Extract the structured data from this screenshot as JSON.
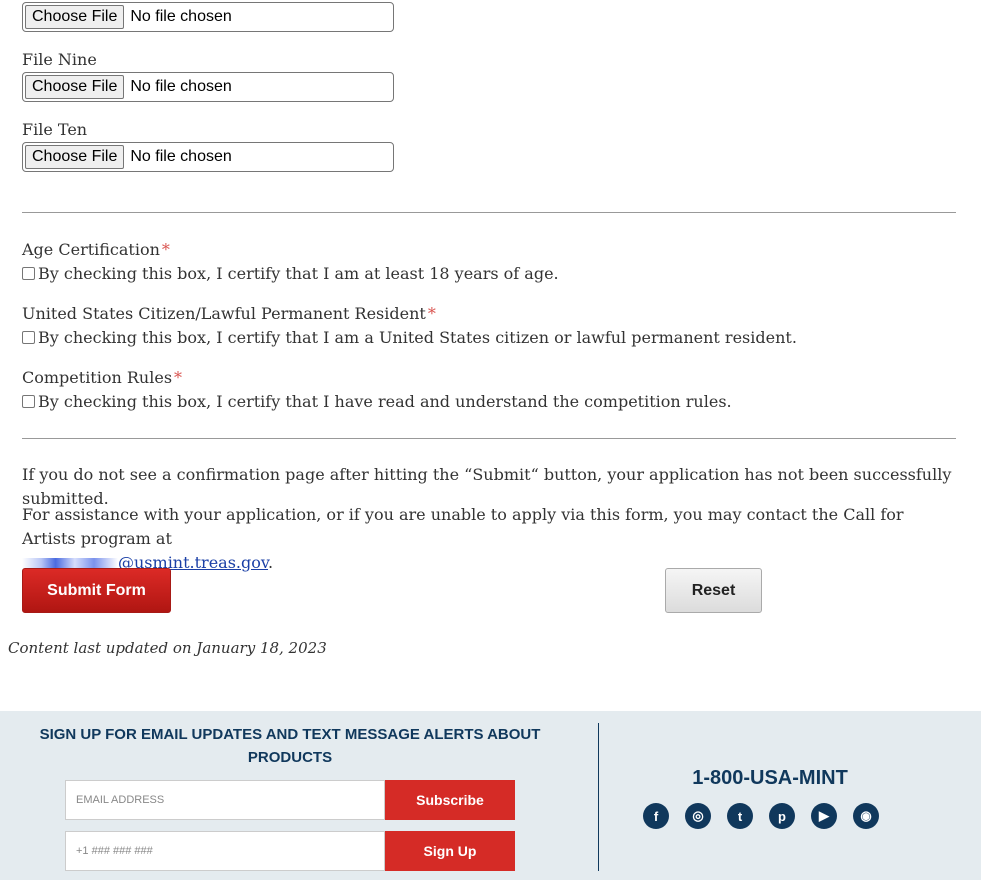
{
  "file_uploads": [
    {
      "label": "",
      "button": "Choose File",
      "status": "No file chosen"
    },
    {
      "label": "File Nine",
      "button": "Choose File",
      "status": "No file chosen"
    },
    {
      "label": "File Ten",
      "button": "Choose File",
      "status": "No file chosen"
    }
  ],
  "certifications": [
    {
      "title": "Age Certification",
      "required": "*",
      "text": "By checking this box, I certify that I am at least 18 years of age."
    },
    {
      "title": "United States Citizen/Lawful Permanent Resident",
      "required": "*",
      "text": "By checking this box, I certify that I am a United States citizen or lawful permanent resident."
    },
    {
      "title": "Competition Rules",
      "required": "*",
      "text": "By checking this box, I certify that I have read and understand the competition rules."
    }
  ],
  "notice": "If you do not see a confirmation page after hitting the “Submit“ button, your application has not been successfully submitted.",
  "assistance": {
    "text": "For assistance with your application, or if you are unable to apply via this form, you may contact the Call for Artists program at",
    "email_domain": "@usmint.treas.gov",
    "trailing": "."
  },
  "buttons": {
    "submit": "Submit Form",
    "reset": "Reset"
  },
  "last_updated": "Content last updated on January 18, 2023",
  "footer": {
    "signup_title": "SIGN UP FOR EMAIL UPDATES AND TEXT MESSAGE ALERTS ABOUT PRODUCTS",
    "email_placeholder": "EMAIL ADDRESS",
    "subscribe_label": "Subscribe",
    "phone_placeholder": "+1 ### ### ###",
    "signup_label": "Sign Up",
    "phone_number": "1-800-USA-MINT",
    "social": [
      {
        "icon": "facebook-icon",
        "glyph": "f"
      },
      {
        "icon": "instagram-icon",
        "glyph": "◎"
      },
      {
        "icon": "twitter-icon",
        "glyph": "t"
      },
      {
        "icon": "pinterest-icon",
        "glyph": "p"
      },
      {
        "icon": "youtube-icon",
        "glyph": "▶"
      },
      {
        "icon": "rss-icon",
        "glyph": "◉"
      }
    ]
  },
  "colors": {
    "submit": "#c91f1b",
    "footer_bg": "#e4ebef",
    "brand_navy": "#10385c",
    "required": "#d9534f"
  }
}
